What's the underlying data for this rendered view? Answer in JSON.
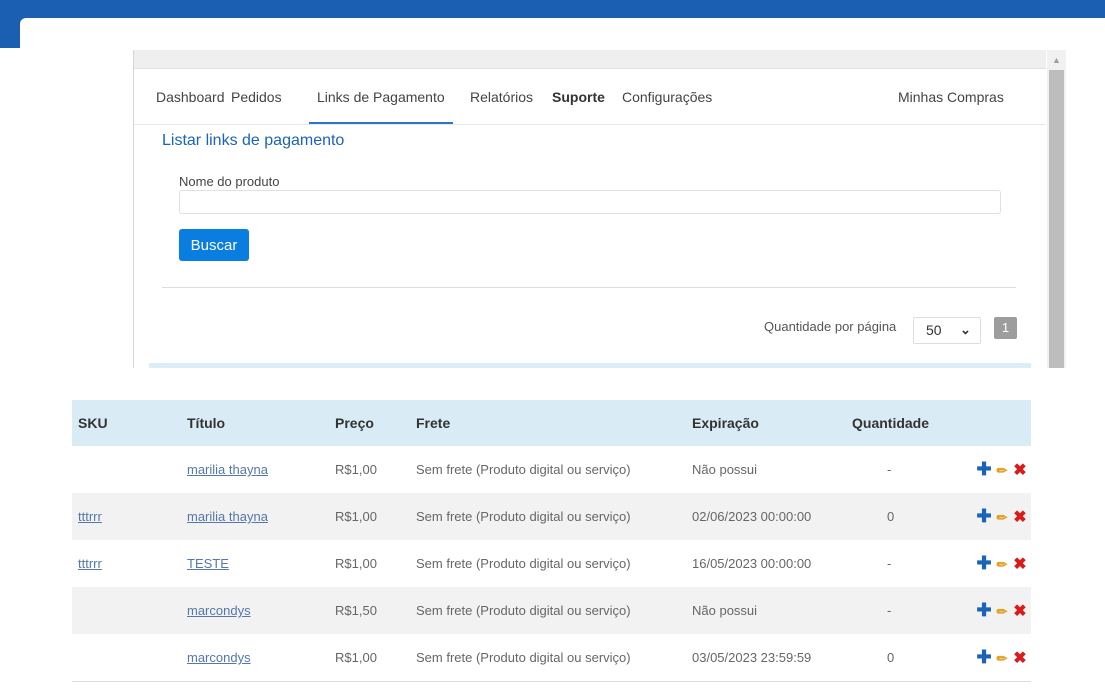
{
  "colors": {
    "header": "#1b5fb3",
    "accent": "#0a7de0",
    "table_header": "#d9ecf6",
    "add_icon": "#1a63b8",
    "edit_icon": "#e0a020",
    "delete_icon": "#d81c1c"
  },
  "nav": {
    "items": [
      "Dashboard",
      "Pedidos",
      "Links de Pagamento",
      "Relatórios",
      "Suporte",
      "Configurações"
    ],
    "active": "Links de Pagamento",
    "right": "Minhas Compras"
  },
  "page": {
    "title": "Listar links de pagamento",
    "product_label": "Nome do produto",
    "product_value": "",
    "search_button": "Buscar",
    "per_page_label": "Quantidade por página",
    "per_page_value": "50",
    "current_page": "1"
  },
  "table": {
    "headers": [
      "SKU",
      "Título",
      "Preço",
      "Frete",
      "Expiração",
      "Quantidade"
    ],
    "rows": [
      {
        "sku": "",
        "title": "marilia thayna",
        "price": "R$1,00",
        "shipping": "Sem frete (Produto digital ou serviço)",
        "expiration": "Não possui",
        "quantity": "-"
      },
      {
        "sku": "tttrrr",
        "title": "marilia thayna",
        "price": "R$1,00",
        "shipping": "Sem frete (Produto digital ou serviço)",
        "expiration": "02/06/2023 00:00:00",
        "quantity": "0"
      },
      {
        "sku": "tttrrr",
        "title": "TESTE",
        "price": "R$1,00",
        "shipping": "Sem frete (Produto digital ou serviço)",
        "expiration": "16/05/2023 00:00:00",
        "quantity": "-"
      },
      {
        "sku": "",
        "title": "marcondys",
        "price": "R$1,50",
        "shipping": "Sem frete (Produto digital ou serviço)",
        "expiration": "Não possui",
        "quantity": "-"
      },
      {
        "sku": "",
        "title": "marcondys",
        "price": "R$1,00",
        "shipping": "Sem frete (Produto digital ou serviço)",
        "expiration": "03/05/2023 23:59:59",
        "quantity": "0"
      }
    ],
    "action_icons": [
      "plus-icon",
      "pencil-icon",
      "delete-icon"
    ]
  }
}
